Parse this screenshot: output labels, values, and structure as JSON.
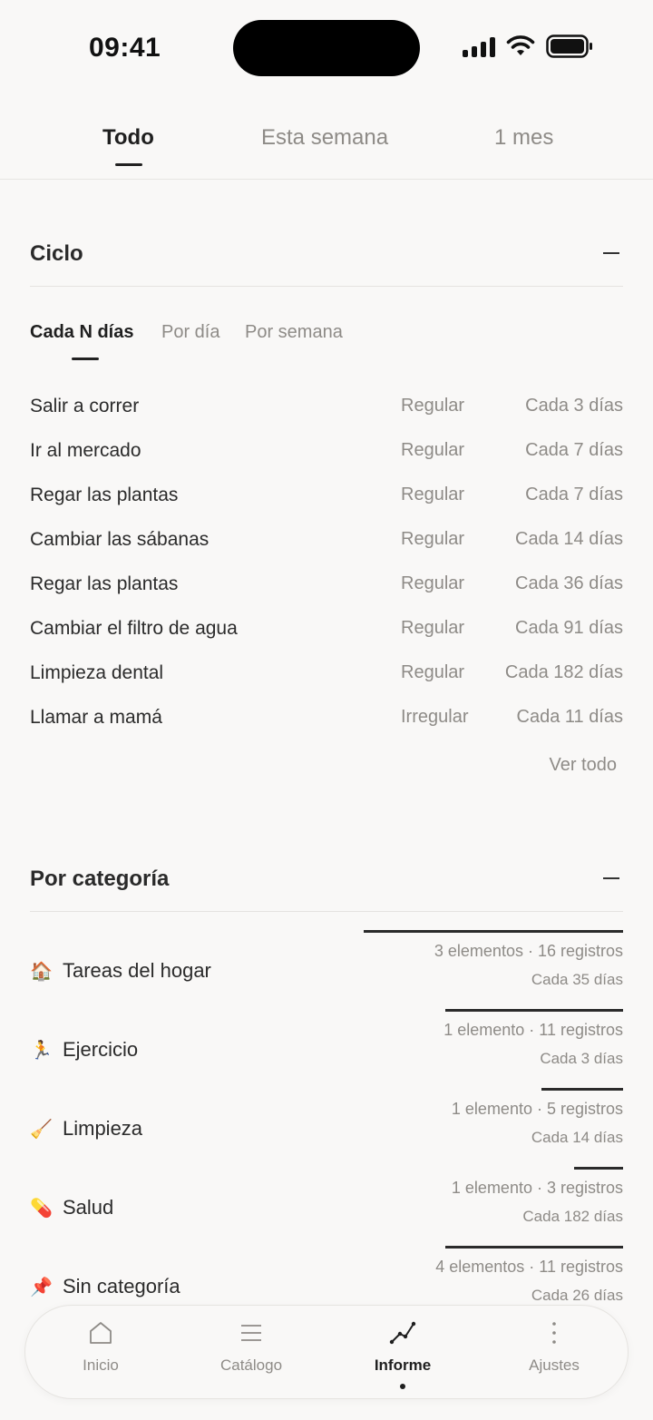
{
  "status_bar": {
    "time": "09:41"
  },
  "top_tabs": [
    {
      "label": "Todo",
      "active": true
    },
    {
      "label": "Esta semana",
      "active": false
    },
    {
      "label": "1 mes",
      "active": false
    }
  ],
  "cycle_section": {
    "title": "Ciclo",
    "sub_tabs": [
      {
        "label": "Cada N días",
        "active": true
      },
      {
        "label": "Por día",
        "active": false
      },
      {
        "label": "Por semana",
        "active": false
      }
    ],
    "rows": [
      {
        "name": "Salir a correr",
        "type": "Regular",
        "freq": "Cada 3 días"
      },
      {
        "name": "Ir al mercado",
        "type": "Regular",
        "freq": "Cada 7 días"
      },
      {
        "name": "Regar las plantas",
        "type": "Regular",
        "freq": "Cada 7 días"
      },
      {
        "name": "Cambiar las sábanas",
        "type": "Regular",
        "freq": "Cada 14 días"
      },
      {
        "name": "Regar las plantas",
        "type": "Regular",
        "freq": "Cada 36 días"
      },
      {
        "name": "Cambiar el filtro de agua",
        "type": "Regular",
        "freq": "Cada 91 días"
      },
      {
        "name": "Limpieza dental",
        "type": "Regular",
        "freq": "Cada 182 días"
      },
      {
        "name": "Llamar a mamá",
        "type": "Irregular",
        "freq": "Cada 11 días"
      }
    ],
    "see_all": "Ver todo"
  },
  "category_section": {
    "title": "Por categoría",
    "rows": [
      {
        "emoji": "🏠",
        "name": "Tareas del hogar",
        "counts": "3 elementos · 16 registros",
        "freq": "Cada 35 días",
        "share": 0.4375
      },
      {
        "emoji": "🏃",
        "name": "Ejercicio",
        "counts": "1 elemento · 11 registros",
        "freq": "Cada 3 días",
        "share": 0.3
      },
      {
        "emoji": "🧹",
        "name": "Limpieza",
        "counts": "1 elemento · 5 registros",
        "freq": "Cada 14 días",
        "share": 0.1375
      },
      {
        "emoji": "💊",
        "name": "Salud",
        "counts": "1 elemento · 3 registros",
        "freq": "Cada 182 días",
        "share": 0.0825
      },
      {
        "emoji": "📌",
        "name": "Sin categoría",
        "counts": "4 elementos · 11 registros",
        "freq": "Cada 26 días",
        "share": 0.3
      }
    ]
  },
  "bottom_nav": [
    {
      "label": "Inicio",
      "icon": "home-icon",
      "active": false
    },
    {
      "label": "Catálogo",
      "icon": "list-icon",
      "active": false
    },
    {
      "label": "Informe",
      "icon": "chart-line-icon",
      "active": true
    },
    {
      "label": "Ajustes",
      "icon": "more-vertical-icon",
      "active": false
    }
  ]
}
